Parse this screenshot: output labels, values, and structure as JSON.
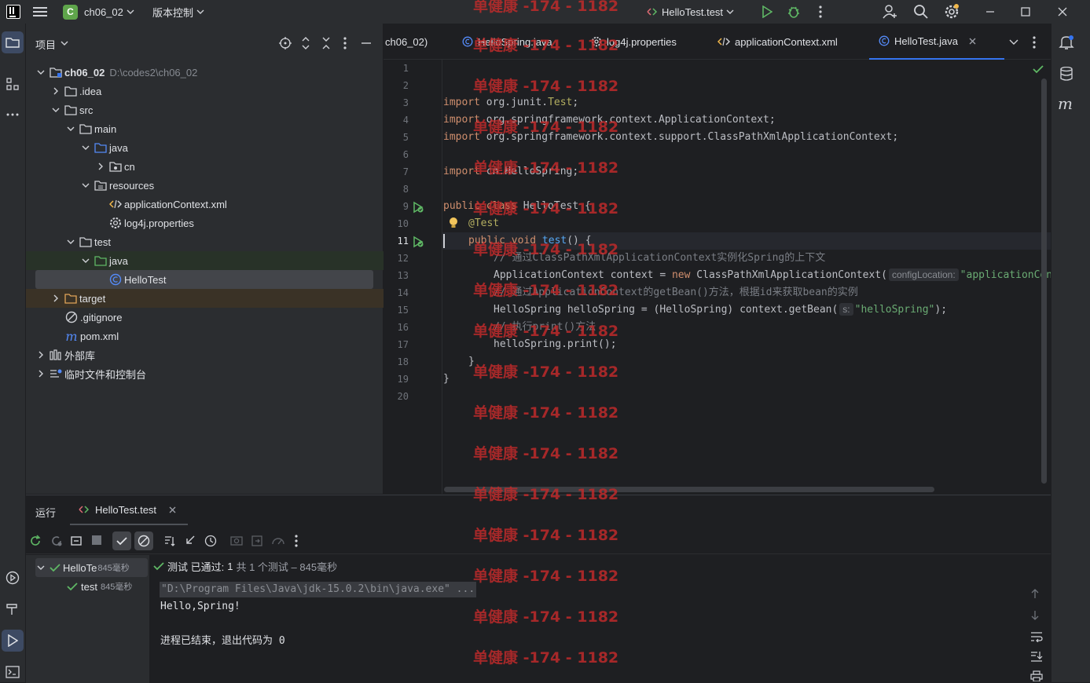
{
  "titlebar": {
    "project_badge": "C",
    "project_name": "ch06_02",
    "vcs_menu": "版本控制",
    "run_config": "HelloTest.test"
  },
  "project_panel": {
    "title": "项目",
    "tree": [
      {
        "label": "ch06_02",
        "path": "D:\\codes2\\ch06_02"
      },
      {
        "label": ".idea"
      },
      {
        "label": "src"
      },
      {
        "label": "main"
      },
      {
        "label": "java"
      },
      {
        "label": "cn"
      },
      {
        "label": "resources"
      },
      {
        "label": "applicationContext.xml"
      },
      {
        "label": "log4j.properties"
      },
      {
        "label": "test"
      },
      {
        "label": "java"
      },
      {
        "label": "HelloTest"
      },
      {
        "label": "target"
      },
      {
        "label": ".gitignore"
      },
      {
        "label": "pom.xml"
      },
      {
        "label": "外部库"
      },
      {
        "label": "临时文件和控制台"
      }
    ]
  },
  "tabs": [
    {
      "label": "ch06_02)"
    },
    {
      "label": "HelloSpring.java"
    },
    {
      "label": "log4j.properties"
    },
    {
      "label": "applicationContext.xml"
    },
    {
      "label": "HelloTest.java"
    }
  ],
  "editor": {
    "line_numbers": [
      "1",
      "2",
      "3",
      "4",
      "5",
      "6",
      "7",
      "8",
      "9",
      "10",
      "11",
      "12",
      "13",
      "14",
      "15",
      "16",
      "17",
      "18",
      "19",
      "20"
    ],
    "code": {
      "l3a": "import ",
      "l3b": "org.junit.",
      "l3c": "Test",
      "l3d": ";",
      "l4a": "import ",
      "l4b": "org.springframework.context.ApplicationContext;",
      "l5a": "import ",
      "l5b": "org.springframework.context.support.ClassPathXmlApplicationContext;",
      "l7a": "import ",
      "l7b": "cn.HelloSpring;",
      "l9a": "public class ",
      "l9b": "HelloTest {",
      "l10a": "@Test",
      "l11a": "public void ",
      "l11b": "test",
      "l11c": "() {",
      "l12": "// 通过ClassPathXmlApplicationContext实例化Spring的上下文",
      "l13a": "ApplicationContext context = ",
      "l13b": "new ",
      "l13c": "ClassPathXmlApplicationContext(",
      "l13hint": "configLocation:",
      "l13d": "\"applicationContext.xml\"",
      "l14": "// 通过ApplicationContext的getBean()方法，根据id来获取bean的实例",
      "l15a": "HelloSpring helloSpring = (HelloSpring) context.getBean(",
      "l15hint": "s:",
      "l15b": "\"helloSpring\"",
      "l15c": ");",
      "l16": "// 执行print()方法",
      "l17": "helloSpring.print();",
      "l18": "}",
      "l19": "}"
    }
  },
  "run_panel": {
    "title": "运行",
    "tab_label": "HelloTest.test",
    "tree": [
      {
        "label": "HelloTe",
        "time": "845毫秒"
      },
      {
        "label": "test",
        "time": "845毫秒"
      }
    ],
    "status_prefix": "测试 已通过:",
    "status_count": "1",
    "status_detail": "共 1 个测试 – 845毫秒",
    "console": [
      "\"D:\\Program Files\\Java\\jdk-15.0.2\\bin\\java.exe\" ...",
      "Hello,Spring!",
      "",
      "进程已结束，退出代码为 0"
    ]
  },
  "watermark": "单健康 -174 - 1182",
  "colors": {
    "accent": "#3574f0",
    "success": "#5fb865",
    "watermark": "#c42b2b"
  }
}
